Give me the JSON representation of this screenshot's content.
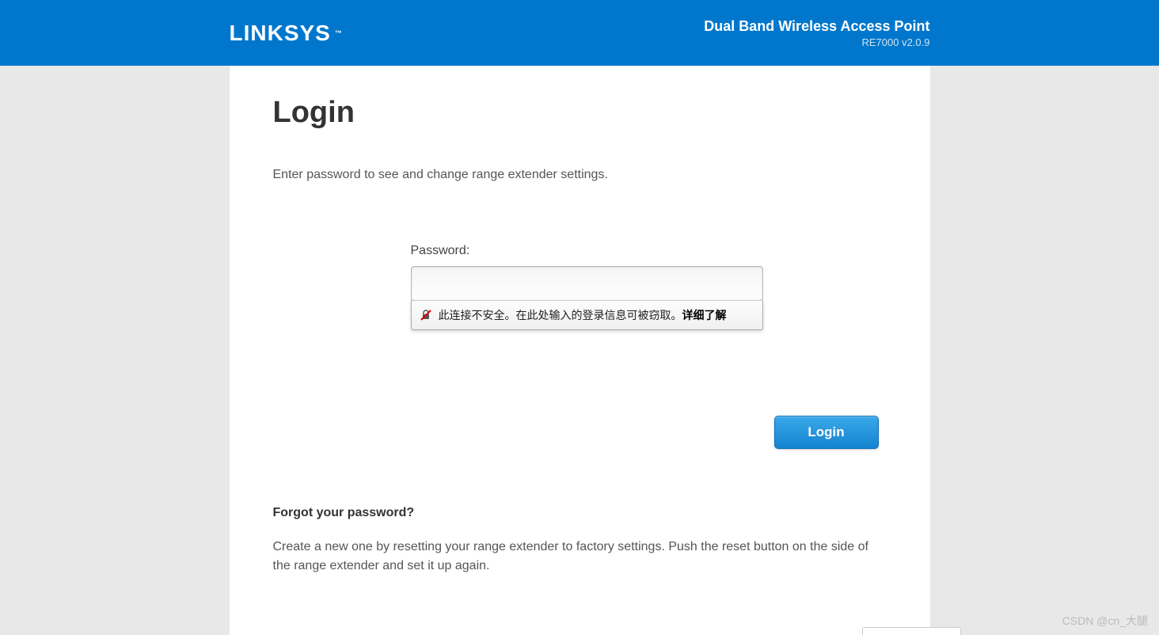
{
  "header": {
    "logo_text": "LINKSYS",
    "logo_tm": "™",
    "product_title": "Dual Band Wireless Access Point",
    "product_version": "RE7000 v2.0.9"
  },
  "login": {
    "page_title": "Login",
    "instruction": "Enter password to see and change range extender settings.",
    "password_label": "Password:",
    "password_value": "",
    "button_label": "Login"
  },
  "warning": {
    "text": "此连接不安全。在此处输入的登录信息可被窃取。",
    "link_text": "详细了解"
  },
  "forgot": {
    "title": "Forgot your password?",
    "text": "Create a new one by resetting your range extender to factory settings. Push the reset button on the side of the range extender and set it up again."
  },
  "watermark": "CSDN @cn_大腿"
}
